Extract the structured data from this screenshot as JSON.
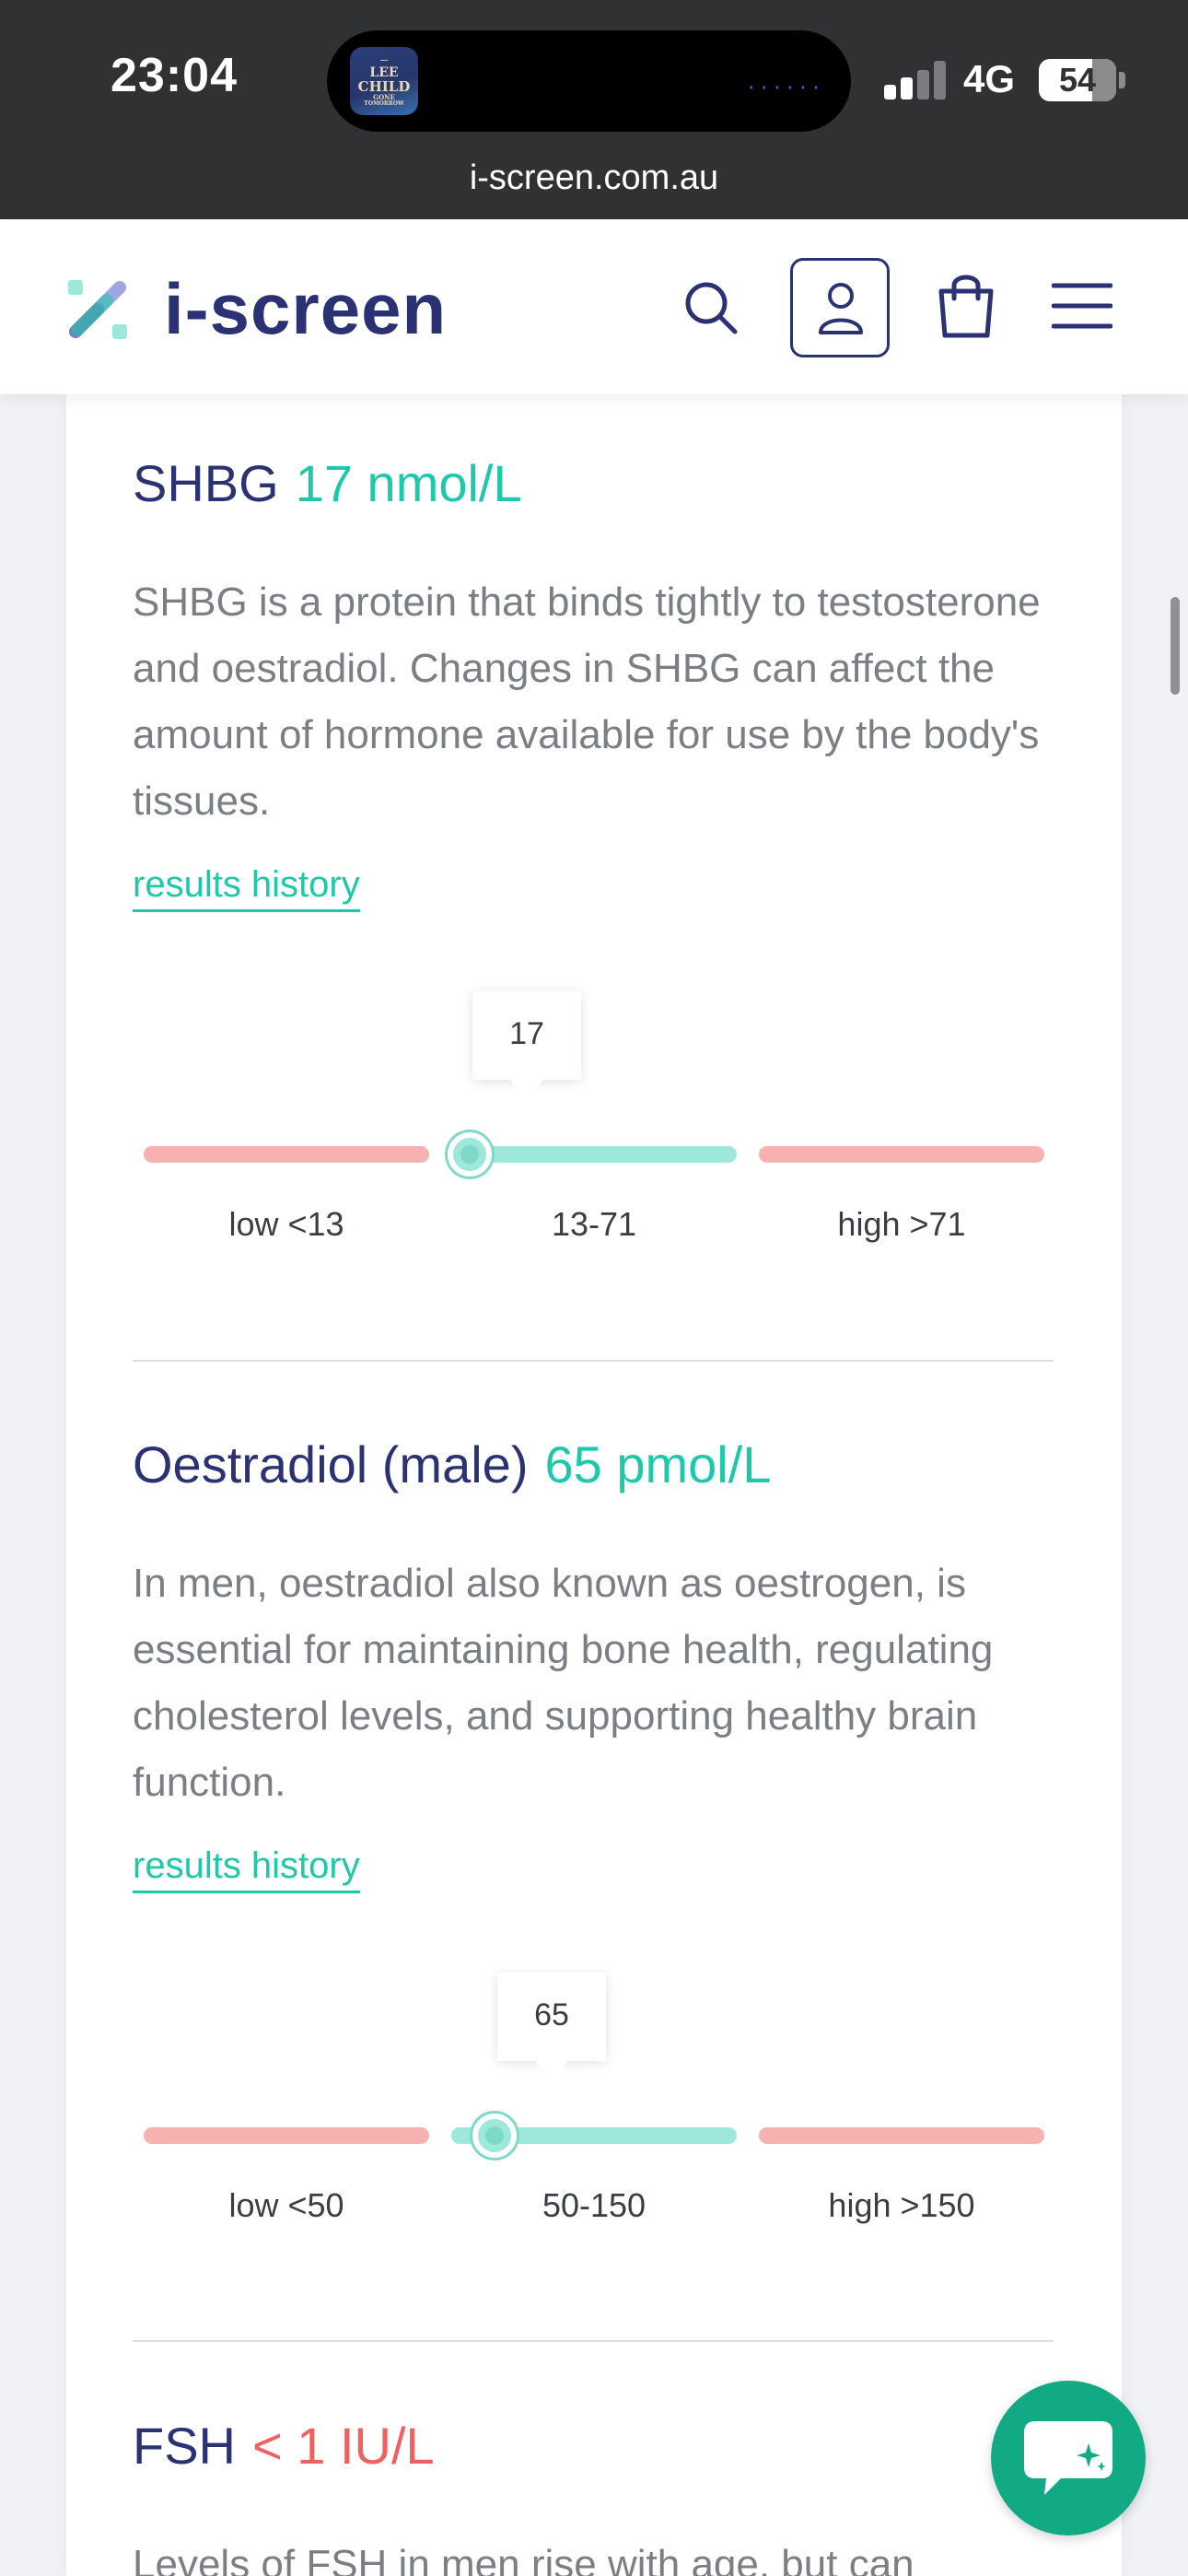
{
  "status_bar": {
    "time": "23:04",
    "network": "4G",
    "battery": "54",
    "url": "i-screen.com.au",
    "now_playing_art_text": [
      "LEE",
      "CHILD",
      "GONE",
      "TOMORROW"
    ]
  },
  "header": {
    "brand": "i-screen",
    "icons": [
      "search-icon",
      "account-icon",
      "cart-icon",
      "menu-icon"
    ]
  },
  "colors": {
    "brand_navy": "#2b3274",
    "accent_teal": "#1ec8aa",
    "low_value_red": "#f06060",
    "range_out": "#f8b1b1",
    "range_in": "#9ee7db",
    "chat_button": "#12a985"
  },
  "results": [
    {
      "name": "SHBG",
      "value": "17 nmol/L",
      "status": "normal",
      "description": "SHBG is a protein that binds tightly to testosterone and oestradiol. Changes in SHBG can affect the amount of hormone available for use by the body's tissues.",
      "history_link": "results history",
      "marker_value": "17",
      "marker_position_in_normal_range": 0.07,
      "ranges": [
        "low <13",
        "13-71",
        "high >71"
      ]
    },
    {
      "name": "Oestradiol (male)",
      "value": "65 pmol/L",
      "status": "normal",
      "description": "In men, oestradiol also known as oestrogen, is essential for maintaining bone health, regulating cholesterol levels, and supporting healthy brain function.",
      "history_link": "results history",
      "marker_value": "65",
      "marker_position_in_normal_range": 0.15,
      "ranges": [
        "low <50",
        "50-150",
        "high >150"
      ]
    },
    {
      "name": "FSH",
      "value": "< 1 IU/L",
      "status": "low",
      "description": "Levels of FSH in men rise with age, but can"
    }
  ],
  "chat": {
    "icon": "chat-sparkle-icon"
  }
}
